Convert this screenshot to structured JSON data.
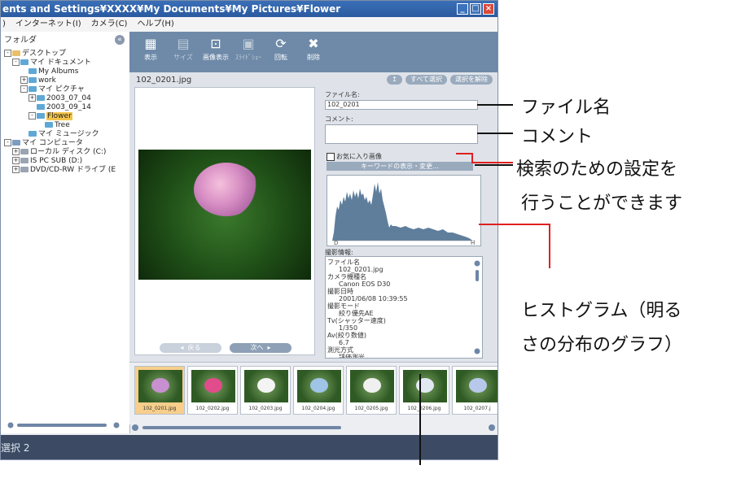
{
  "window": {
    "title": "ents and Settings¥XXXX¥My Documents¥My Pictures¥Flower",
    "menu": [
      ")",
      "インターネット(I)",
      "カメラ(C)",
      "ヘルプ(H)"
    ]
  },
  "left_pane": {
    "header": "フォルダ",
    "tree": [
      {
        "label": "デスクトップ",
        "level": 0,
        "toggle": "-",
        "icon": "desk"
      },
      {
        "label": "マイ ドキュメント",
        "level": 1,
        "toggle": "-",
        "icon": "fold"
      },
      {
        "label": "My Albums",
        "level": 2,
        "toggle": "",
        "icon": "fold"
      },
      {
        "label": "work",
        "level": 2,
        "toggle": "+",
        "icon": "fold"
      },
      {
        "label": "マイ ピクチャ",
        "level": 2,
        "toggle": "-",
        "icon": "fold"
      },
      {
        "label": "2003_07_04",
        "level": 3,
        "toggle": "+",
        "icon": "fold"
      },
      {
        "label": "2003_09_14",
        "level": 3,
        "toggle": "",
        "icon": "fold"
      },
      {
        "label": "Flower",
        "level": 3,
        "toggle": "-",
        "icon": "fold",
        "selected": true
      },
      {
        "label": "Tree",
        "level": 4,
        "toggle": "",
        "icon": "fold"
      },
      {
        "label": "マイ ミュージック",
        "level": 2,
        "toggle": "",
        "icon": "fold"
      },
      {
        "label": "マイ コンピュータ",
        "level": 0,
        "toggle": "-",
        "icon": "pc"
      },
      {
        "label": "ローカル ディスク (C:)",
        "level": 1,
        "toggle": "+",
        "icon": "drive"
      },
      {
        "label": "IS PC SUB (D:)",
        "level": 1,
        "toggle": "+",
        "icon": "drive"
      },
      {
        "label": "DVD/CD-RW ドライブ (E",
        "level": 1,
        "toggle": "+",
        "icon": "drive"
      }
    ]
  },
  "toolbar": {
    "tools": [
      {
        "label": "表示",
        "icon": "grid-icon",
        "dim": false
      },
      {
        "label": "サイズ",
        "icon": "resize-icon",
        "dim": true
      },
      {
        "label": "画像表示",
        "icon": "image-icon",
        "dim": false
      },
      {
        "label": "ｽﾗｲﾄﾞｼｮｰ",
        "icon": "slideshow-icon",
        "dim": true
      },
      {
        "label": "回転",
        "icon": "rotate-icon",
        "dim": false
      },
      {
        "label": "削除",
        "icon": "trash-icon",
        "dim": false
      }
    ]
  },
  "main": {
    "current_file": "102_0201.jpg",
    "select_all": "すべて選択",
    "deselect": "選択を解除",
    "up_arrow": "↥",
    "prev": "戻る",
    "next": "次へ",
    "info": {
      "filename_label": "ファイル名:",
      "filename_value": "102_0201",
      "comment_label": "コメント:",
      "favorite_label": "お気に入り画像",
      "keyword_button": "キーワードの表示・変更...",
      "hist_d": "D",
      "hist_h": "H",
      "shooting_label": "撮影情報:",
      "shooting_info": [
        {
          "text": "ファイル名",
          "indent": false
        },
        {
          "text": "102_0201.jpg",
          "indent": true
        },
        {
          "text": "カメラ機種名",
          "indent": false
        },
        {
          "text": "Canon EOS D30",
          "indent": true
        },
        {
          "text": "撮影日時",
          "indent": false
        },
        {
          "text": "2001/06/08 10:39:55",
          "indent": true
        },
        {
          "text": "撮影モード",
          "indent": false
        },
        {
          "text": "絞り優先AE",
          "indent": true
        },
        {
          "text": "Tv(シャッター速度)",
          "indent": false
        },
        {
          "text": "1/350",
          "indent": true
        },
        {
          "text": "Av(絞り数値)",
          "indent": false
        },
        {
          "text": "6.7",
          "indent": true
        },
        {
          "text": "測光方式",
          "indent": false
        },
        {
          "text": "評価測光",
          "indent": true
        }
      ]
    }
  },
  "thumbnails": [
    {
      "name": "102_0201.jpg",
      "selected": true,
      "flower": "#c890d0"
    },
    {
      "name": "102_0202.jpg",
      "selected": false,
      "flower": "#e04c8c"
    },
    {
      "name": "102_0203.jpg",
      "selected": false,
      "flower": "#f4f4f4"
    },
    {
      "name": "102_0204.jpg",
      "selected": false,
      "flower": "#9fc4e6"
    },
    {
      "name": "102_0205.jpg",
      "selected": false,
      "flower": "#f0f0f0"
    },
    {
      "name": "102_0206.jpg",
      "selected": false,
      "flower": "#e2e8f2"
    },
    {
      "name": "102_0207.j",
      "selected": false,
      "flower": "#b8c8ea"
    }
  ],
  "status": "選択  2",
  "annotations": {
    "filename": "ファイル名",
    "comment": "コメント",
    "search_line1": "検索のための設定を",
    "search_line2": "行うことができます",
    "hist_line1": "ヒストグラム（明る",
    "hist_line2": "さの分布のグラフ）"
  },
  "colors": {
    "toolbar": "#6e8aa8",
    "selected_folder": "#f3c44a",
    "selected_thumb": "#f7cf8b",
    "status_bar": "#3c4b63",
    "annotation_line": "#e02020"
  }
}
